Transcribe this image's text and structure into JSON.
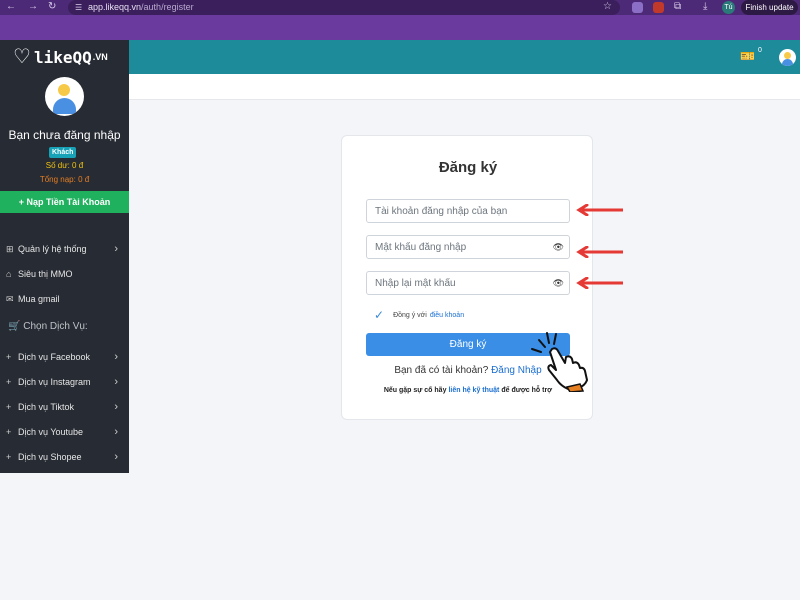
{
  "browser": {
    "url_domain": "app.likeqq.vn",
    "url_path": "/auth/register",
    "profile_initials": "Tú",
    "finish_update": "Finish update"
  },
  "sidebar": {
    "logo_text": "likeQQ",
    "logo_suffix": ".VN",
    "user_name": "Bạn chưa đăng nhập",
    "role": "Khách",
    "balance": "Số dư: 0 đ",
    "total_topup": "Tổng nạp: 0 đ",
    "topup_button": "Nạp Tiền Tài Khoản",
    "menu": [
      {
        "label": "Quản lý hệ thống",
        "icon": "grid-icon"
      },
      {
        "label": "Siêu thị MMO",
        "icon": "store-icon"
      },
      {
        "label": "Mua gmail",
        "icon": "mail-icon"
      }
    ],
    "services_heading": "Chọn Dịch Vụ:",
    "services": [
      {
        "label": "Dịch vụ Facebook"
      },
      {
        "label": "Dịch vụ Instagram"
      },
      {
        "label": "Dịch vụ Tiktok"
      },
      {
        "label": "Dịch vụ Youtube"
      },
      {
        "label": "Dịch vụ Shopee"
      }
    ]
  },
  "header": {
    "ticket_count": "0"
  },
  "form": {
    "title": "Đăng ký",
    "username_placeholder": "Tài khoản đăng nhập của bạn",
    "password_placeholder": "Mật khẩu đăng nhập",
    "confirm_placeholder": "Nhập lại mật khẩu",
    "agree_text": "Đồng ý với",
    "terms_link": "điều khoản",
    "submit": "Đăng ký",
    "have_account": "Bạn đã có tài khoản?",
    "login_link": "Đăng Nhập",
    "support_prefix": "Nếu gặp sự cố hãy",
    "support_link": "liên hệ kỹ thuật",
    "support_suffix": "để được hỗ trợ"
  },
  "colors": {
    "browser_frame": "#6a3a9e",
    "sidebar_bg": "#272b33",
    "header_bg": "#1e8b9b",
    "topup_green": "#1fb15e",
    "primary_blue": "#3a8ee6",
    "annotation_red": "#e53935"
  }
}
